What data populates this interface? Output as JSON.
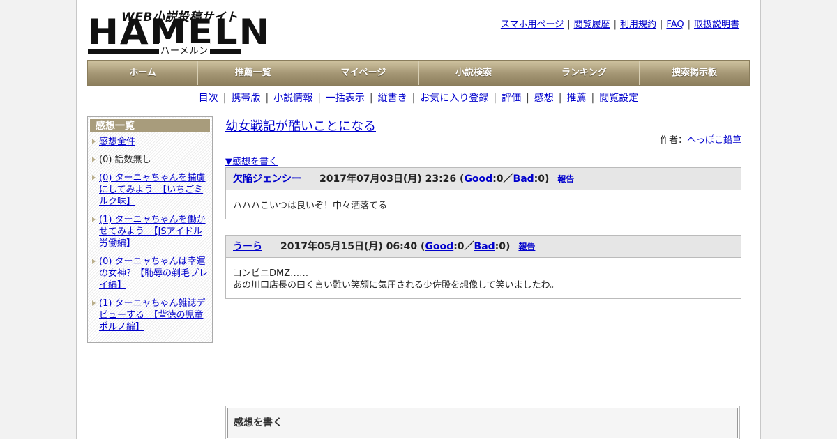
{
  "logo": {
    "tagline": "WEB小説投稿サイト",
    "name": "HAMELN",
    "reading": "ハーメルン"
  },
  "top_links": [
    "スマホ用ページ",
    "閲覧履歴",
    "利用規約",
    "FAQ",
    "取扱説明書"
  ],
  "main_nav": [
    "ホーム",
    "推薦一覧",
    "マイページ",
    "小説検索",
    "ランキング",
    "捜索掲示板"
  ],
  "sub_nav": [
    "目次",
    "携帯版",
    "小説情報",
    "一括表示",
    "縦書き",
    "お気に入り登録",
    "評価",
    "感想",
    "推薦",
    "閲覧設定"
  ],
  "sidebar": {
    "title": "感想一覧",
    "items": [
      {
        "label": "感想全件",
        "link": true
      },
      {
        "label": "(0) 話数無し",
        "link": false
      },
      {
        "label": "(0) ターニャちゃんを捕虜にしてみよう　【いちごミルク味】",
        "link": true
      },
      {
        "label": "(1) ターニャちゃんを働かせてみよう　【JSアイドル労働編】",
        "link": true
      },
      {
        "label": "(0) ターニャちゃんは幸運の女神？【恥辱の剃毛プレイ編】",
        "link": true
      },
      {
        "label": "(1) ターニャちゃん雑誌デビューする　【背徳の児童ポルノ編】",
        "link": true
      }
    ]
  },
  "content": {
    "title": "幼女戦記が酷いことになる",
    "author_label": "作者：",
    "author_name": "へっぽこ鉛筆",
    "write_link": "▼感想を書く",
    "reviews": [
      {
        "name": "欠陥ジェンシー",
        "date": "2017年07月03日(月) 23:26 (",
        "good_label": "Good",
        "good_count": ":0／",
        "bad_label": "Bad",
        "bad_count": ":0)",
        "report": "報告",
        "body": [
          "ハハハこいつは良いぞ！中々洒落てる"
        ]
      },
      {
        "name": "うーら",
        "date": "2017年05月15日(月) 06:40 (",
        "good_label": "Good",
        "good_count": ":0／",
        "bad_label": "Bad",
        "bad_count": ":0)",
        "report": "報告",
        "body": [
          "コンビニDMZ……",
          "あの川口店長の曰く言い難い笑顔に気圧される少佐殿を想像して笑いましたわ。"
        ]
      }
    ],
    "write_box_title": "感想を書く"
  }
}
